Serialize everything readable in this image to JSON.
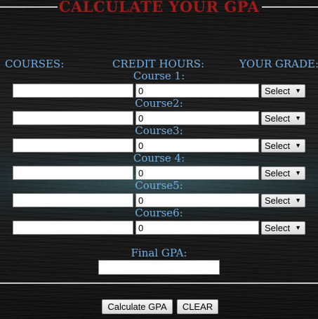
{
  "title": "CALCULATE YOUR GPA",
  "headers": {
    "courses": "COURSES:",
    "credit_hours": "CREDIT HOURS:",
    "grade": "YOUR GRADE:"
  },
  "courses": [
    {
      "label": "Course 1:",
      "name": "",
      "credit_hours": "0",
      "grade": "Select"
    },
    {
      "label": "Course2:",
      "name": "",
      "credit_hours": "0",
      "grade": "Select"
    },
    {
      "label": "Course3:",
      "name": "",
      "credit_hours": "0",
      "grade": "Select"
    },
    {
      "label": "Course 4:",
      "name": "",
      "credit_hours": "0",
      "grade": "Select"
    },
    {
      "label": "Course5:",
      "name": "",
      "credit_hours": "0",
      "grade": "Select"
    },
    {
      "label": "Course6:",
      "name": "",
      "credit_hours": "0",
      "grade": "Select"
    }
  ],
  "final_gpa": {
    "label": "Final GPA:",
    "value": ""
  },
  "buttons": {
    "calculate": "Calculate GPA",
    "clear": "CLEAR"
  },
  "colors": {
    "title": "#9e1b1b",
    "labels": "#6fb0e6",
    "rules": "#c8c8c8"
  }
}
